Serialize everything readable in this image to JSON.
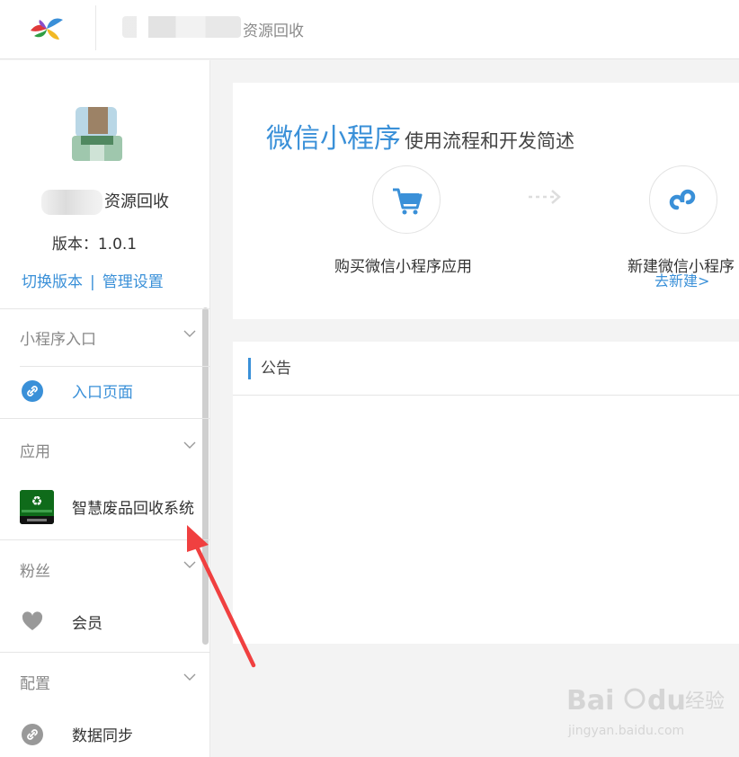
{
  "header": {
    "app_title": "资源回收"
  },
  "sidebar": {
    "account_name_suffix": "资源回收",
    "version_text": "版本：1.0.1",
    "switch_version": "切换版本",
    "separator": "|",
    "manage_settings": "管理设置",
    "sections": [
      {
        "label": "小程序入口",
        "items": [
          {
            "label": "入口页面",
            "icon": "link-icon",
            "active": true
          }
        ]
      },
      {
        "label": "应用",
        "items": [
          {
            "label": "智慧废品回收系统",
            "icon": "recycle-app-icon"
          }
        ]
      },
      {
        "label": "粉丝",
        "items": [
          {
            "label": "会员",
            "icon": "heart-icon"
          }
        ]
      },
      {
        "label": "配置",
        "items": [
          {
            "label": "数据同步",
            "icon": "link-icon"
          }
        ]
      }
    ]
  },
  "main": {
    "heading_big": "微信小程序",
    "heading_small": "使用流程和开发简述",
    "steps": [
      {
        "label": "购买微信小程序应用",
        "icon": "cart-icon"
      },
      {
        "label": "新建微信小程序",
        "icon": "mini-program-icon",
        "link": "去新建>"
      }
    ],
    "notice_title": "公告"
  },
  "colors": {
    "accent": "#3a90d8",
    "annotation_arrow": "#f04040"
  }
}
